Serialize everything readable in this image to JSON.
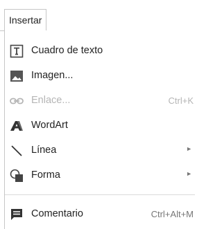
{
  "menubar": {
    "active_menu": "Insertar"
  },
  "menu": {
    "items": [
      {
        "label": "Cuadro de texto",
        "icon": "text-box-icon"
      },
      {
        "label": "Imagen...",
        "icon": "image-icon"
      },
      {
        "label": "Enlace...",
        "shortcut": "Ctrl+K",
        "icon": "link-icon",
        "disabled": true
      },
      {
        "label": "WordArt",
        "icon": "wordart-icon"
      },
      {
        "label": "Línea",
        "icon": "line-icon",
        "submenu_arrow": "►"
      },
      {
        "label": "Forma",
        "icon": "shape-icon",
        "submenu_arrow": "►"
      },
      {
        "label": "Comentario",
        "shortcut": "Ctrl+Alt+M",
        "icon": "comment-icon"
      }
    ]
  },
  "colors": {
    "text": "#222222",
    "disabled_text": "#b5b5b5",
    "icon": "#444444",
    "border": "#c6c6c6"
  }
}
